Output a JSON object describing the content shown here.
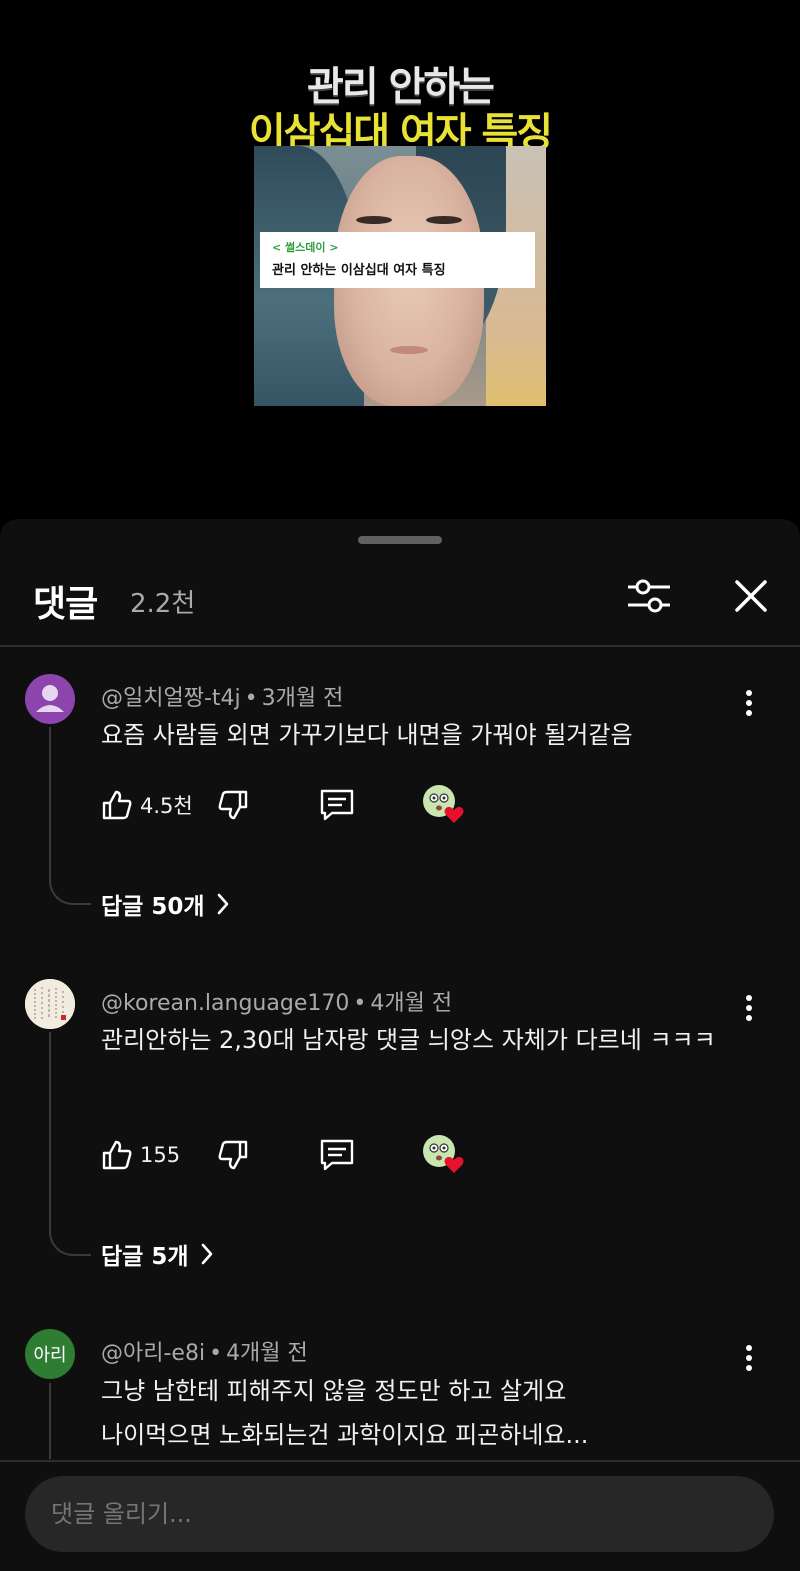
{
  "video": {
    "title_line1": "관리 안하는",
    "title_line2": "이삼십대 여자 특징",
    "caption_tag": "< 썰스데이 >",
    "caption_text": "관리 안하는 이삼십대 여자 특징"
  },
  "panel": {
    "title": "댓글",
    "count": "2.2천"
  },
  "comments": [
    {
      "author": "@일치얼짱-t4j",
      "time": "3개월 전",
      "text": "요즘 사람들 외면 가꾸기보다 내면을 가꿔야 될거같음",
      "likes": "4.5천",
      "replies": "답글 50개"
    },
    {
      "author": "@korean.language170",
      "time": "4개월 전",
      "text": "관리안하는 2,30대 남자랑 댓글 늬앙스 자체가 다르네 ㅋㅋㅋ",
      "likes": "155",
      "replies": "답글 5개"
    },
    {
      "author": "@아리-e8i",
      "time": "4개월 전",
      "avatar_text": "아리",
      "text_line1": "그냥 남한테 피해주지 않을 정도만 하고 살게요",
      "text_line2": "나이먹으면 노화되는건 과학이지요 피곤하네요..."
    }
  ],
  "input": {
    "placeholder": "댓글 올리기..."
  },
  "colors": {
    "panel_bg": "#0f0f0f",
    "title_yellow": "#e9e236",
    "avatar1": "#8e44ad",
    "avatar3": "#2e7d32",
    "heart": "#e8112d"
  }
}
